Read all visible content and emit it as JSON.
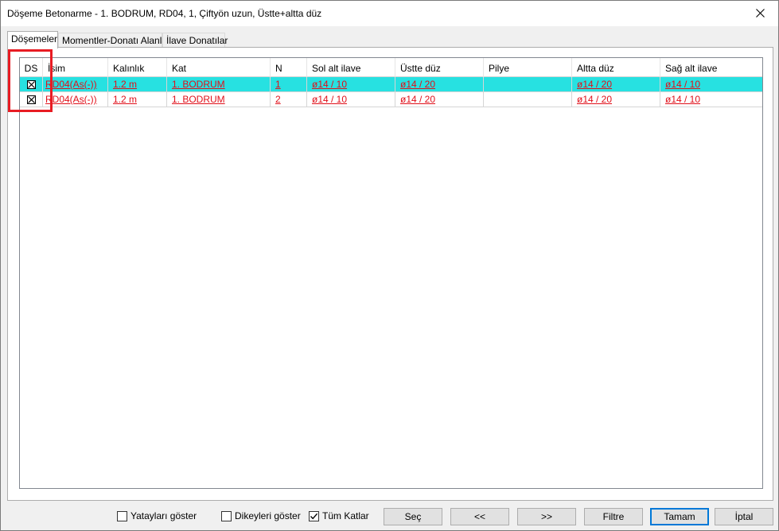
{
  "window": {
    "title": "Döşeme Betonarme - 1. BODRUM, RD04, 1, Çiftyön uzun, Üstte+altta düz"
  },
  "tabs": [
    {
      "label": "Döşemeler",
      "active": true
    },
    {
      "label": "Momentler-Donatı Alanları",
      "active": false
    },
    {
      "label": "İlave Donatılar",
      "active": false
    }
  ],
  "grid": {
    "columns": [
      "DS",
      "İsim",
      "Kalınlık",
      "Kat",
      "N",
      "Sol alt ilave",
      "Üstte düz",
      "Pilye",
      "Altta düz",
      "Sağ alt ilave"
    ],
    "rows": [
      {
        "selected": true,
        "ds_checked": true,
        "isim": "RD04(As(-))",
        "kalinlik": "1.2 m",
        "kat": "1. BODRUM",
        "n": "1",
        "sol_alt_ilave": "ø14 / 10",
        "ustte_duz": "ø14 / 20",
        "pilye": "",
        "altta_duz": "ø14 / 20",
        "sag_alt_ilave": "ø14 / 10"
      },
      {
        "selected": false,
        "ds_checked": true,
        "isim": "RD04(As(-))",
        "kalinlik": "1.2 m",
        "kat": "1. BODRUM",
        "n": "2",
        "sol_alt_ilave": "ø14 / 10",
        "ustte_duz": "ø14 / 20",
        "pilye": "",
        "altta_duz": "ø14 / 20",
        "sag_alt_ilave": "ø14 / 10"
      }
    ]
  },
  "bottom": {
    "yataylari_goster": {
      "label": "Yatayları göster",
      "checked": false
    },
    "dikeyleri_goster": {
      "label": "Dikeyleri göster",
      "checked": false
    },
    "tum_katlar": {
      "label": "Tüm Katlar",
      "checked": true
    },
    "sec_label": "Seç",
    "prev_label": "<<",
    "next_label": ">>",
    "filtre_label": "Filtre",
    "tamam_label": "Tamam",
    "iptal_label": "İptal"
  },
  "colors": {
    "selected_row": "#27e1e1",
    "link_text": "#e0101a",
    "highlight_box": "#e81c23",
    "default_button_border": "#0078d7"
  },
  "icons": {
    "close": "close-icon",
    "checked": "checkbox-checked-icon"
  }
}
